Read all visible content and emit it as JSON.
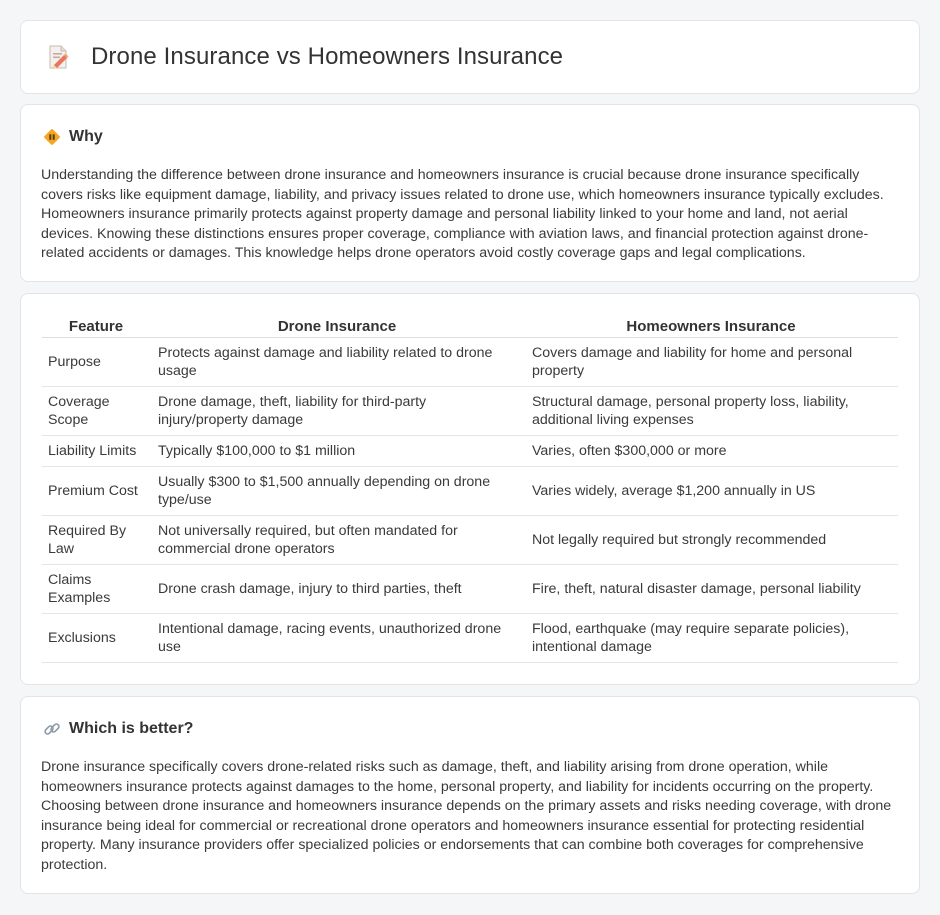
{
  "header": {
    "title": "Drone Insurance vs Homeowners Insurance",
    "icon": "document-pencil-icon"
  },
  "why": {
    "title": "Why",
    "icon": "diamond-sign-icon",
    "text": "Understanding the difference between drone insurance and homeowners insurance is crucial because drone insurance specifically covers risks like equipment damage, liability, and privacy issues related to drone use, which homeowners insurance typically excludes. Homeowners insurance primarily protects against property damage and personal liability linked to your home and land, not aerial devices. Knowing these distinctions ensures proper coverage, compliance with aviation laws, and financial protection against drone-related accidents or damages. This knowledge helps drone operators avoid costly coverage gaps and legal complications."
  },
  "table": {
    "headers": [
      "Feature",
      "Drone Insurance",
      "Homeowners Insurance"
    ],
    "rows": [
      [
        "Purpose",
        "Protects against damage and liability related to drone usage",
        "Covers damage and liability for home and personal property"
      ],
      [
        "Coverage Scope",
        "Drone damage, theft, liability for third-party injury/property damage",
        "Structural damage, personal property loss, liability, additional living expenses"
      ],
      [
        "Liability Limits",
        "Typically $100,000 to $1 million",
        "Varies, often $300,000 or more"
      ],
      [
        "Premium Cost",
        "Usually $300 to $1,500 annually depending on drone type/use",
        "Varies widely, average $1,200 annually in US"
      ],
      [
        "Required By Law",
        "Not universally required, but often mandated for commercial drone operators",
        "Not legally required but strongly recommended"
      ],
      [
        "Claims Examples",
        "Drone crash damage, injury to third parties, theft",
        "Fire, theft, natural disaster damage, personal liability"
      ],
      [
        "Exclusions",
        "Intentional damage, racing events, unauthorized drone use",
        "Flood, earthquake (may require separate policies), intentional damage"
      ]
    ]
  },
  "better": {
    "title": "Which is better?",
    "icon": "link-icon",
    "text": "Drone insurance specifically covers drone-related risks such as damage, theft, and liability arising from drone operation, while homeowners insurance protects against damages to the home, personal property, and liability for incidents occurring on the property. Choosing between drone insurance and homeowners insurance depends on the primary assets and risks needing coverage, with drone insurance being ideal for commercial or recreational drone operators and homeowners insurance essential for protecting residential property. Many insurance providers offer specialized policies or endorsements that can combine both coverages for comprehensive protection."
  }
}
